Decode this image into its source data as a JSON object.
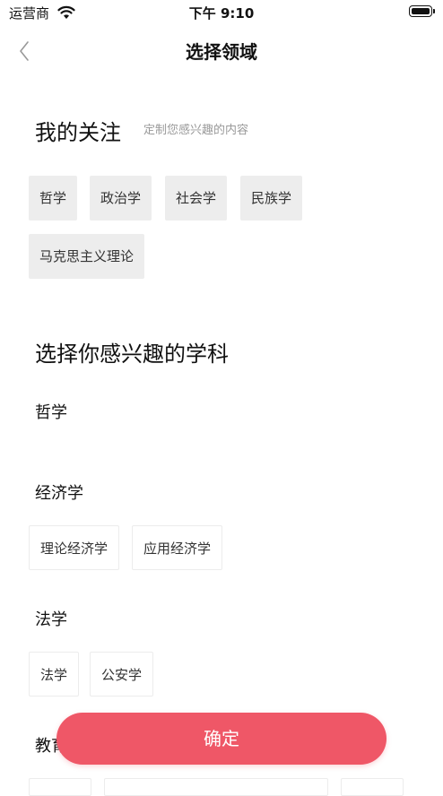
{
  "status_bar": {
    "carrier": "运营商",
    "time": "下午 9:10"
  },
  "nav": {
    "title": "选择领域",
    "back_icon": "chevron-left-icon"
  },
  "following": {
    "title": "我的关注",
    "subtitle": "定制您感兴趣的内容",
    "tags": [
      "哲学",
      "政治学",
      "社会学",
      "民族学",
      "马克思主义理论"
    ]
  },
  "choose": {
    "title": "选择你感兴趣的学科",
    "groups": [
      {
        "name": "哲学",
        "items": []
      },
      {
        "name": "经济学",
        "items": [
          "理论经济学",
          "应用经济学"
        ]
      },
      {
        "name": "法学",
        "items": [
          "法学",
          "公安学"
        ]
      },
      {
        "name": "教育学",
        "items": []
      }
    ]
  },
  "confirm_label": "确定",
  "colors": {
    "accent": "#ef5767",
    "chip_bg": "#ededed",
    "muted_text": "#999999"
  }
}
